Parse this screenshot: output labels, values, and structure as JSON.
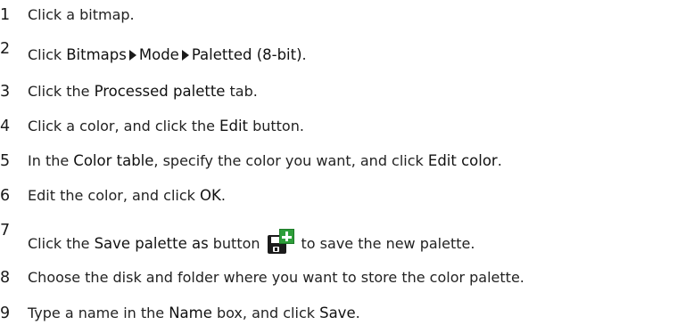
{
  "steps": [
    {
      "number": "1",
      "parts": [
        "Click a bitmap."
      ]
    },
    {
      "number": "2",
      "prefix": "Click ",
      "menu": [
        "Bitmaps",
        "Mode",
        "Paletted (8-bit)"
      ],
      "suffix": "."
    },
    {
      "number": "3",
      "prefix": "Click the ",
      "emphasis": "Processed palette",
      "suffix": " tab."
    },
    {
      "number": "4",
      "prefix": "Click a color, and click the ",
      "emphasis": "Edit",
      "suffix": " button."
    },
    {
      "number": "5",
      "prefix": "In the ",
      "emphasis": "Color table",
      "middle": ", specify the color you want, and click ",
      "emphasis2": "Edit color",
      "suffix": "."
    },
    {
      "number": "6",
      "prefix": "Edit the color, and click ",
      "emphasis": "OK",
      "suffix": "."
    },
    {
      "number": "7",
      "prefix": "Click the ",
      "emphasis": "Save palette as",
      "middle": " button",
      "icon": "save-palette-as-icon",
      "suffix": "to save the new palette."
    },
    {
      "number": "8",
      "prefix": "Choose the disk and folder where you want to store the color palette."
    },
    {
      "number": "9",
      "prefix": "Type a name in the ",
      "emphasis": "Name",
      "middle": " box, and click ",
      "emphasis2": "Save",
      "suffix": "."
    }
  ],
  "colors": {
    "text": "#222222",
    "icon_disk": "#1b1b1b",
    "icon_plus": "#2e9e3a"
  }
}
